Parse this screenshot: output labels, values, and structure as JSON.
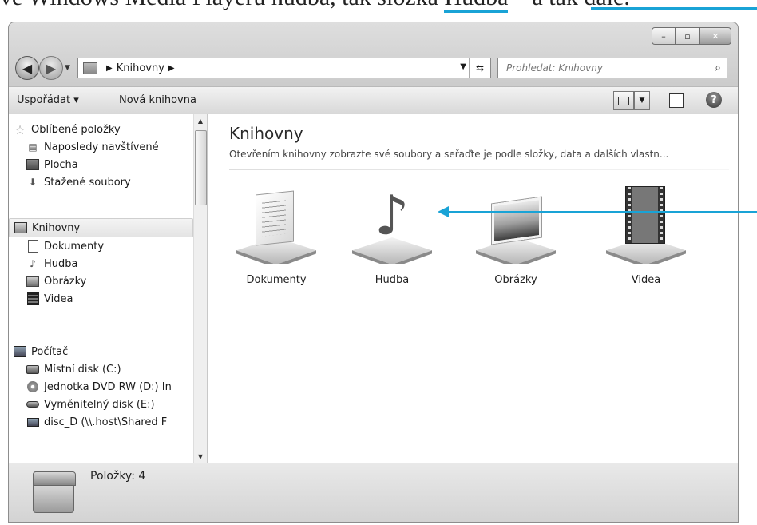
{
  "caption": {
    "text_before": "ve Windows Media Playeru hudba, tak složka ",
    "highlight": "Hudba",
    "text_after": " – a tak dále."
  },
  "window_controls": {
    "minimize": "–",
    "maximize": "▫",
    "close": "✕"
  },
  "address": {
    "crumb": "Knihovny",
    "search_placeholder": "Prohledat: Knihovny"
  },
  "toolbar": {
    "organize": "Uspořádat ▾",
    "new_library": "Nová knihovna"
  },
  "sidebar": {
    "favorites": {
      "label": "Oblíbené položky",
      "items": [
        {
          "label": "Naposledy navštívené",
          "icon": "recent-places-icon"
        },
        {
          "label": "Plocha",
          "icon": "desktop-icon"
        },
        {
          "label": "Stažené soubory",
          "icon": "downloads-icon"
        }
      ]
    },
    "libraries": {
      "label": "Knihovny",
      "items": [
        {
          "label": "Dokumenty",
          "icon": "documents-icon"
        },
        {
          "label": "Hudba",
          "icon": "music-icon"
        },
        {
          "label": "Obrázky",
          "icon": "pictures-icon"
        },
        {
          "label": "Videa",
          "icon": "videos-icon"
        }
      ]
    },
    "computer": {
      "label": "Počítač",
      "items": [
        {
          "label": "Místní disk (C:)",
          "icon": "local-disk-icon"
        },
        {
          "label": "Jednotka DVD RW (D:) In",
          "icon": "dvd-drive-icon"
        },
        {
          "label": "Vyměnitelný disk (E:)",
          "icon": "removable-disk-icon"
        },
        {
          "label": "disc_D (\\\\.host\\Shared F",
          "icon": "network-drive-icon"
        }
      ]
    }
  },
  "main": {
    "title": "Knihovny",
    "description": "Otevřením knihovny zobrazte své soubory a seřaďte je podle složky, data a dalších vlastn...",
    "libraries": [
      {
        "label": "Dokumenty",
        "icon": "documents-library-icon"
      },
      {
        "label": "Hudba",
        "icon": "music-library-icon"
      },
      {
        "label": "Obrázky",
        "icon": "pictures-library-icon"
      },
      {
        "label": "Videa",
        "icon": "videos-library-icon"
      }
    ]
  },
  "status": {
    "items_count": "Položky: 4"
  },
  "colors": {
    "callout": "#19a3d6"
  }
}
